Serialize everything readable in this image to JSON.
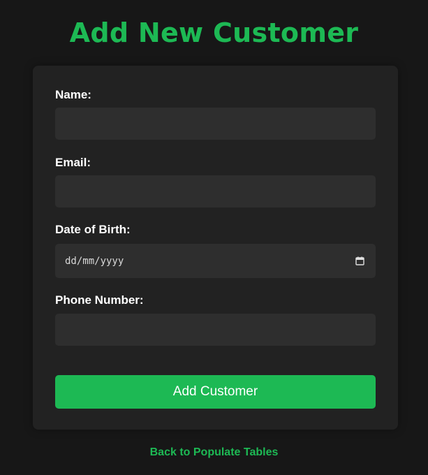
{
  "page": {
    "title": "Add New Customer"
  },
  "form": {
    "name_label": "Name:",
    "name_value": "",
    "email_label": "Email:",
    "email_value": "",
    "dob_label": "Date of Birth:",
    "dob_placeholder": "dd/mm/yyyy",
    "phone_label": "Phone Number:",
    "phone_value": "",
    "submit_label": "Add Customer"
  },
  "footer": {
    "back_link": "Back to Populate Tables"
  },
  "icons": {
    "date_picker": "calendar-icon"
  },
  "colors": {
    "accent": "#1db954",
    "background": "#171717",
    "card": "#222222",
    "input": "#2e2e2e"
  }
}
